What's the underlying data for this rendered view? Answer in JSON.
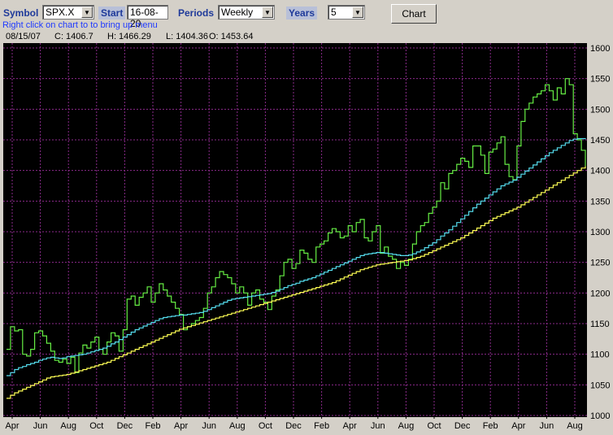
{
  "toolbar": {
    "symbol_label": "Symbol",
    "symbol_value": "SPX.X",
    "start_label": "Start",
    "start_value": "16-08-20",
    "periods_label": "Periods",
    "periods_value": "Weekly",
    "years_label": "Years",
    "years_value": "5",
    "chart_button": "Chart",
    "hint": "Right click on chart to to bring up menu"
  },
  "status": {
    "date": "08/15/07",
    "close": "C: 1406.7",
    "high": "H: 1466.29",
    "low": "L: 1404.36",
    "open": "O: 1453.64"
  },
  "colors": {
    "background": "#000000",
    "grid": "#8a2a8a",
    "price": "#66ee44",
    "ma_short": "#55ddee",
    "ma_long": "#ffff55"
  },
  "chart_data": {
    "type": "line",
    "ylim": [
      1000,
      1600
    ],
    "yticks": [
      "1600",
      "1550",
      "1500",
      "1450",
      "1400",
      "1350",
      "1300",
      "1250",
      "1200",
      "1150",
      "1100",
      "1050",
      "1000"
    ],
    "xticks": [
      "Apr",
      "Jun",
      "Aug",
      "Oct",
      "Dec",
      "Feb",
      "Apr",
      "Jun",
      "Aug",
      "Oct",
      "Dec",
      "Feb",
      "Apr",
      "Jun",
      "Aug",
      "Oct",
      "Dec",
      "Feb",
      "Apr",
      "Jun",
      "Aug"
    ],
    "series": [
      {
        "key": "price",
        "values": [
          1108,
          1145,
          1138,
          1140,
          1100,
          1097,
          1108,
          1135,
          1138,
          1130,
          1118,
          1105,
          1090,
          1087,
          1092,
          1085,
          1095,
          1070,
          1102,
          1115,
          1110,
          1120,
          1128,
          1108,
          1100,
          1120,
          1135,
          1130,
          1105,
          1140,
          1190,
          1195,
          1180,
          1193,
          1200,
          1210,
          1185,
          1200,
          1215,
          1205,
          1195,
          1185,
          1175,
          1165,
          1140,
          1145,
          1150,
          1155,
          1160,
          1175,
          1200,
          1210,
          1225,
          1235,
          1230,
          1225,
          1215,
          1200,
          1210,
          1200,
          1180,
          1200,
          1205,
          1190,
          1185,
          1173,
          1195,
          1205,
          1228,
          1250,
          1255,
          1240,
          1248,
          1270,
          1265,
          1255,
          1250,
          1275,
          1280,
          1285,
          1298,
          1305,
          1300,
          1290,
          1293,
          1310,
          1300,
          1315,
          1320,
          1290,
          1285,
          1300,
          1310,
          1265,
          1275,
          1260,
          1255,
          1240,
          1250,
          1245,
          1255,
          1280,
          1300,
          1310,
          1315,
          1330,
          1340,
          1350,
          1380,
          1370,
          1395,
          1400,
          1410,
          1420,
          1415,
          1405,
          1440,
          1440,
          1425,
          1395,
          1430,
          1435,
          1445,
          1455,
          1410,
          1390,
          1385,
          1440,
          1480,
          1500,
          1510,
          1520,
          1525,
          1530,
          1540,
          1530,
          1515,
          1535,
          1525,
          1550,
          1540,
          1460,
          1450,
          1433,
          1407
        ]
      },
      {
        "key": "ma_short",
        "values": [
          1065,
          1070,
          1075,
          1078,
          1080,
          1083,
          1085,
          1087,
          1090,
          1092,
          1094,
          1095,
          1094,
          1093,
          1094,
          1096,
          1097,
          1098,
          1099,
          1100,
          1102,
          1104,
          1106,
          1108,
          1110,
          1113,
          1117,
          1120,
          1124,
          1128,
          1132,
          1136,
          1140,
          1143,
          1146,
          1149,
          1152,
          1155,
          1158,
          1160,
          1161,
          1162,
          1163,
          1164,
          1164,
          1165,
          1166,
          1167,
          1168,
          1170,
          1173,
          1176,
          1179,
          1182,
          1185,
          1188,
          1190,
          1191,
          1192,
          1193,
          1194,
          1195,
          1196,
          1197,
          1198,
          1199,
          1201,
          1203,
          1206,
          1209,
          1212,
          1214,
          1216,
          1219,
          1221,
          1223,
          1225,
          1228,
          1231,
          1234,
          1237,
          1240,
          1243,
          1246,
          1249,
          1252,
          1255,
          1258,
          1261,
          1263,
          1264,
          1265,
          1266,
          1266,
          1265,
          1264,
          1263,
          1262,
          1261,
          1261,
          1262,
          1264,
          1267,
          1270,
          1274,
          1278,
          1282,
          1287,
          1293,
          1298,
          1303,
          1309,
          1315,
          1321,
          1327,
          1333,
          1339,
          1345,
          1350,
          1355,
          1360,
          1365,
          1370,
          1375,
          1378,
          1381,
          1384,
          1389,
          1394,
          1399,
          1404,
          1409,
          1414,
          1419,
          1424,
          1429,
          1433,
          1437,
          1441,
          1445,
          1449,
          1451,
          1452,
          1452,
          1451
        ]
      },
      {
        "key": "ma_long",
        "values": [
          1028,
          1033,
          1037,
          1040,
          1043,
          1046,
          1049,
          1052,
          1055,
          1058,
          1061,
          1063,
          1064,
          1065,
          1066,
          1067,
          1069,
          1071,
          1073,
          1075,
          1077,
          1079,
          1081,
          1083,
          1085,
          1087,
          1090,
          1093,
          1096,
          1099,
          1102,
          1105,
          1108,
          1111,
          1114,
          1117,
          1120,
          1123,
          1126,
          1129,
          1132,
          1135,
          1138,
          1141,
          1143,
          1145,
          1147,
          1149,
          1151,
          1153,
          1155,
          1157,
          1159,
          1161,
          1163,
          1165,
          1167,
          1169,
          1171,
          1173,
          1175,
          1177,
          1179,
          1181,
          1183,
          1185,
          1187,
          1189,
          1191,
          1193,
          1195,
          1197,
          1199,
          1201,
          1203,
          1205,
          1207,
          1209,
          1211,
          1213,
          1215,
          1217,
          1220,
          1223,
          1226,
          1229,
          1232,
          1235,
          1238,
          1240,
          1242,
          1244,
          1246,
          1247,
          1248,
          1249,
          1250,
          1251,
          1252,
          1253,
          1254,
          1256,
          1258,
          1260,
          1263,
          1266,
          1269,
          1272,
          1275,
          1278,
          1281,
          1284,
          1287,
          1290,
          1294,
          1298,
          1302,
          1306,
          1310,
          1314,
          1318,
          1322,
          1325,
          1328,
          1331,
          1334,
          1337,
          1340,
          1344,
          1348,
          1352,
          1356,
          1360,
          1364,
          1368,
          1372,
          1376,
          1380,
          1384,
          1388,
          1392,
          1396,
          1400,
          1404,
          1407
        ]
      }
    ]
  }
}
